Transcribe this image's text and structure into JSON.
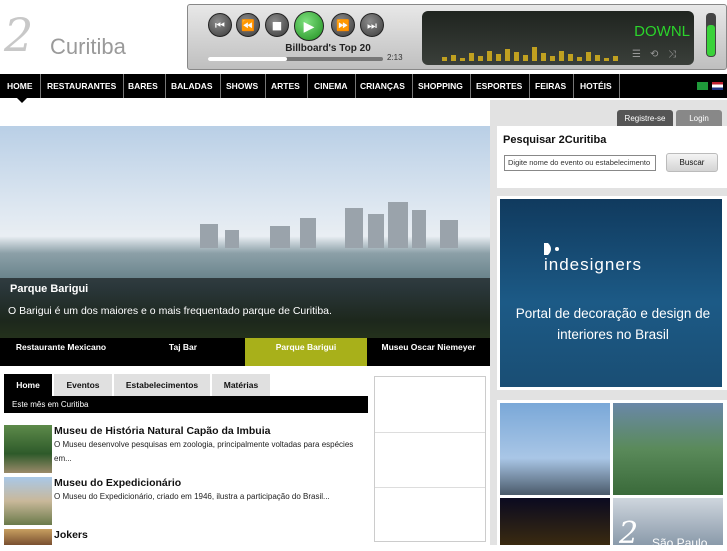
{
  "brand": {
    "mark": "2",
    "name": "Curitiba"
  },
  "player": {
    "track": "Billboard's Top 20",
    "time": "2:13",
    "progress": 0.45,
    "screen_text": "DOWNL",
    "volume": 0.7,
    "buttons": [
      "prev-icon",
      "rewind-icon",
      "stop-icon",
      "play-icon",
      "forward-icon",
      "next-icon"
    ]
  },
  "nav": {
    "items": [
      "HOME",
      "RESTAURANTES",
      "BARES",
      "BALADAS",
      "SHOWS",
      "ARTES",
      "CINEMA",
      "CRIANÇAS",
      "SHOPPING",
      "ESPORTES",
      "FEIRAS",
      "HOTÉIS"
    ],
    "active": "HOME"
  },
  "hero": {
    "title": "Parque Barigui",
    "desc": "O Barigui é um dos maiores e o mais frequentado parque de Curitiba."
  },
  "slides": [
    "Restaurante Mexicano",
    "Taj Bar",
    "Parque Barigui",
    "Museu Oscar Niemeyer"
  ],
  "slides_active": "Parque Barigui",
  "tabs": [
    "Home",
    "Eventos",
    "Estabelecimentos",
    "Matérias"
  ],
  "subtab": "Este mês em Curitiba",
  "list": [
    {
      "title": "Museu de História Natural Capão da Imbuia",
      "desc": "O Museu desenvolve pesquisas em zoologia, principalmente voltadas para espécies em..."
    },
    {
      "title": "Museu do Expedicionário",
      "desc": "O Museu do Expedicionário, criado em 1946, ilustra a participação do Brasil..."
    },
    {
      "title": "Jokers",
      "desc": ""
    }
  ],
  "account": {
    "register": "Registre-se",
    "login": "Login"
  },
  "search": {
    "title": "Pesquisar 2Curitiba",
    "placeholder": "Digite nome do evento ou estabelecimento",
    "button": "Buscar"
  },
  "ad": {
    "brand": "indesigners",
    "tagline": "Portal de decoração e design de interiores no Brasil"
  },
  "gallery": {
    "mark": "2",
    "label": "São Paulo"
  }
}
